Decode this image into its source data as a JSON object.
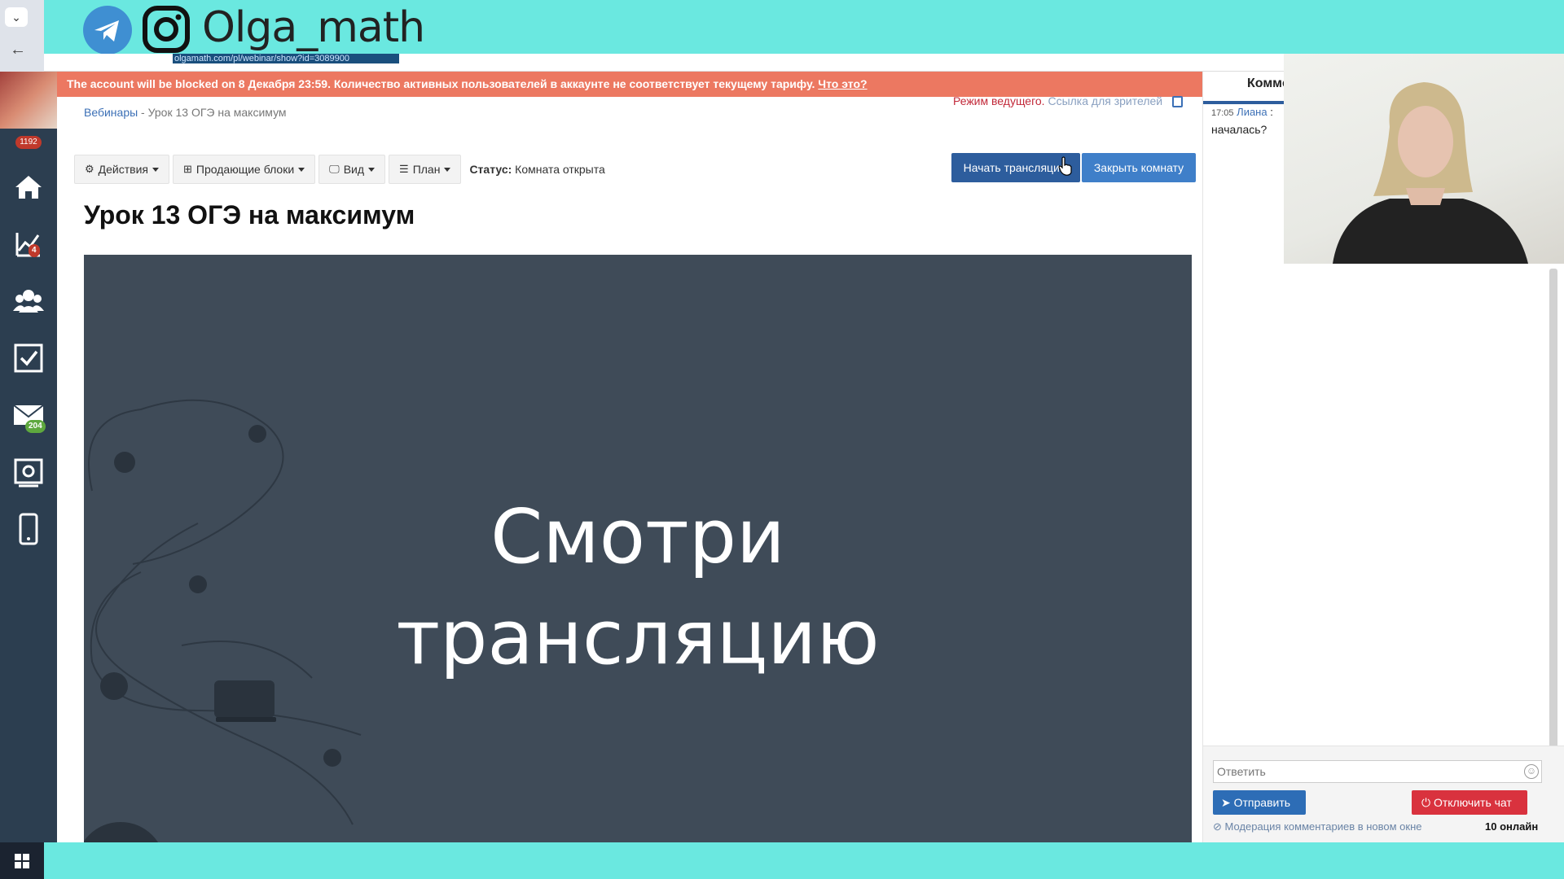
{
  "banner": {
    "handle": "Olga_math"
  },
  "browser": {
    "url": "olgamath.com/pl/webinar/show?id=3089900"
  },
  "sidebar": {
    "counter": "1192",
    "items": [
      {
        "icon": "home-icon"
      },
      {
        "icon": "chart-icon",
        "badge": "4"
      },
      {
        "icon": "users-icon"
      },
      {
        "icon": "checkbox-icon"
      },
      {
        "icon": "mail-icon",
        "badge": "204"
      },
      {
        "icon": "settings-icon"
      },
      {
        "icon": "mobile-icon"
      }
    ]
  },
  "alert": {
    "text": "The account will be blocked on 8 Декабря 23:59. Количество активных пользователей в аккаунте не соответствует текущему тарифу. ",
    "link": "Что это?"
  },
  "breadcrumb": {
    "root": "Вебинары",
    "sep": " - ",
    "current": "Урок 13 ОГЭ на максимум"
  },
  "mode": {
    "label": "Режим ведущего.",
    "viewers_link": "Ссылка для зрителей"
  },
  "toolbar": {
    "actions": "Действия",
    "blocks": "Продающие блоки",
    "view": "Вид",
    "plan": "План",
    "status_label": "Статус:",
    "status_value": "Комната открыта",
    "start": "Начать трансляцию",
    "close": "Закрыть комнату"
  },
  "title": "Урок 13 ОГЭ на максимум",
  "player": {
    "line1": "Смотри",
    "line2": "трансляцию"
  },
  "chat": {
    "tab": "Комментарии",
    "message": {
      "time": "17:05",
      "author": "Лиана",
      "sep": " : ",
      "text": "началась?"
    },
    "reply_placeholder": "Ответить",
    "send": "Отправить",
    "disable": "Отключить чат",
    "moderation": "Модерация комментариев в новом окне",
    "online": "10 онлайн"
  },
  "colors": {
    "banner": "#6ae8e0",
    "alert": "#ec7861",
    "primary": "#2d5d9d",
    "danger": "#d9323e",
    "player_bg": "#3f4b58"
  }
}
